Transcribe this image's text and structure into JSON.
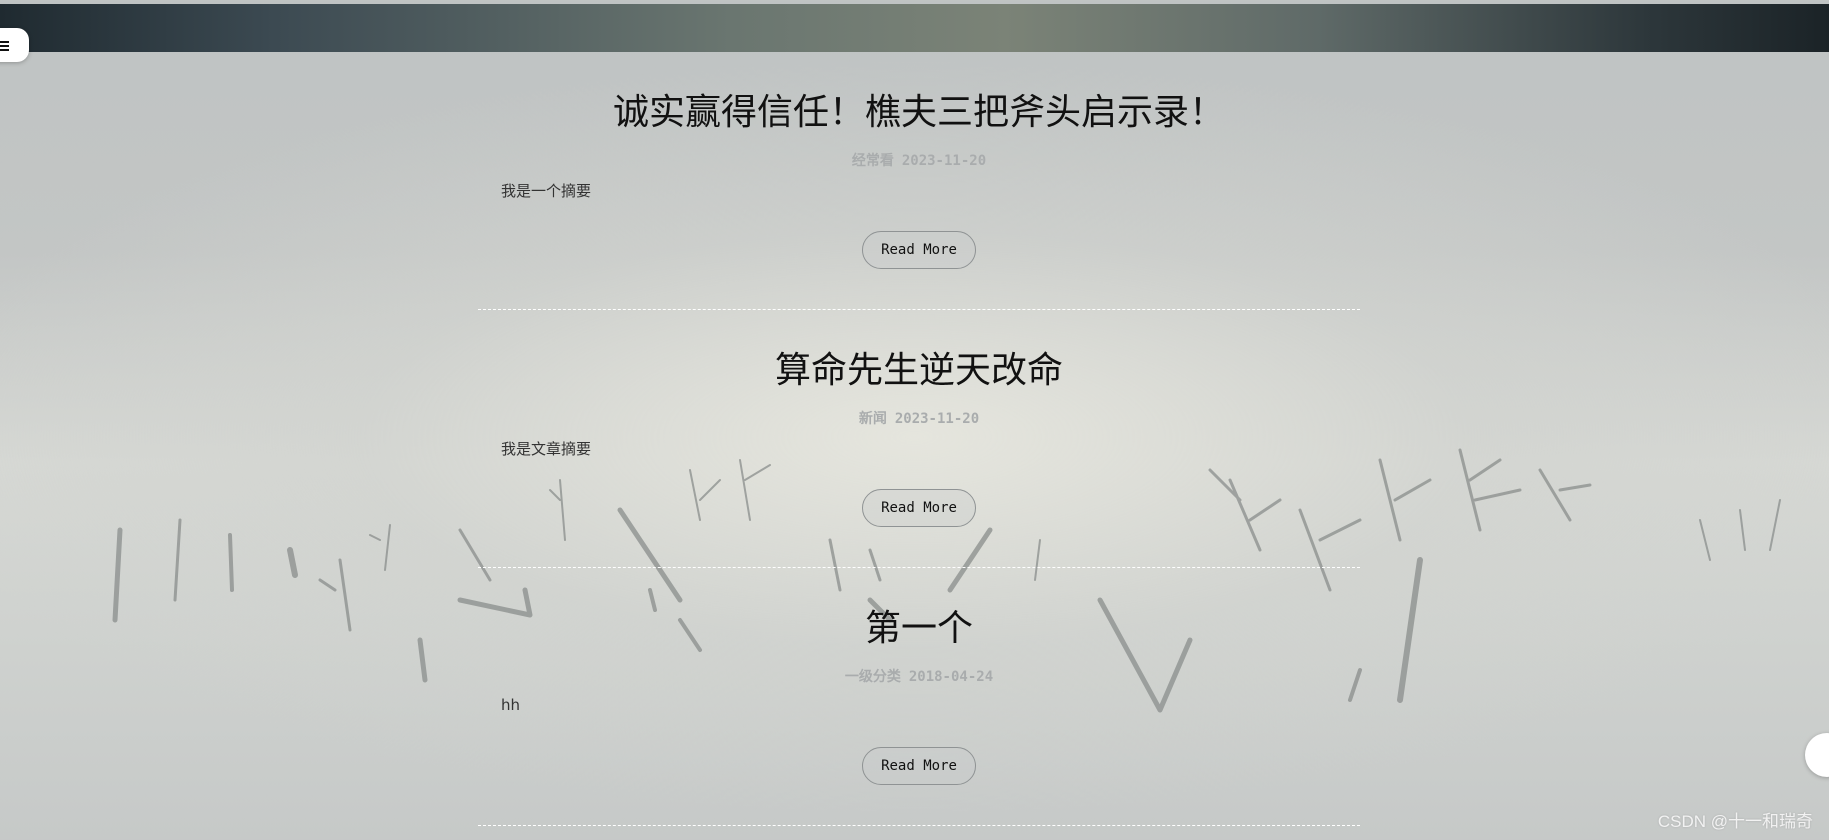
{
  "nav": {
    "menu_icon": "hamburger-icon"
  },
  "posts": [
    {
      "title": "诚实赢得信任！樵夫三把斧头启示录！",
      "category": "经常看",
      "date": "2023-11-20",
      "summary": "我是一个摘要",
      "read_more": "Read More"
    },
    {
      "title": "算命先生逆天改命",
      "category": "新闻",
      "date": "2023-11-20",
      "summary": "我是文章摘要",
      "read_more": "Read More"
    },
    {
      "title": "第一个",
      "category": "一级分类",
      "date": "2018-04-24",
      "summary": "hh",
      "read_more": "Read More"
    }
  ],
  "watermark": "CSDN @十一和瑞奇",
  "colors": {
    "meta": "#a9acad",
    "banner_dark": "#1f2a30"
  }
}
